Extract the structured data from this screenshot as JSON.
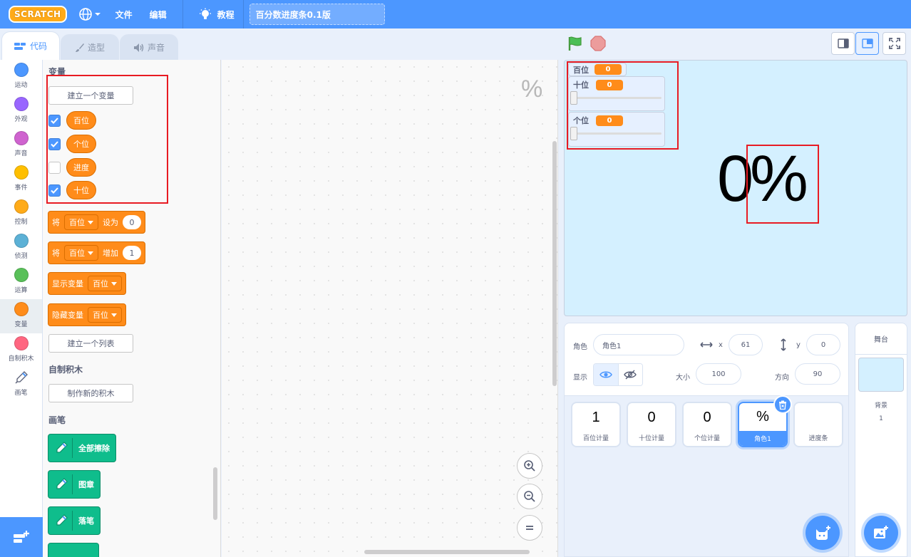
{
  "menubar": {
    "logo": "SCRATCH",
    "file": "文件",
    "edit": "编辑",
    "tutorials": "教程",
    "project_title": "百分数进度条0.1版"
  },
  "tabs": [
    {
      "label": "代码",
      "icon": "code-icon",
      "active": true
    },
    {
      "label": "造型",
      "icon": "brush-icon",
      "active": false
    },
    {
      "label": "声音",
      "icon": "speaker-icon",
      "active": false
    }
  ],
  "categories": [
    {
      "label": "运动",
      "color": "#4c97ff"
    },
    {
      "label": "外观",
      "color": "#9966ff"
    },
    {
      "label": "声音",
      "color": "#cf63cf"
    },
    {
      "label": "事件",
      "color": "#ffbf00"
    },
    {
      "label": "控制",
      "color": "#ffab19"
    },
    {
      "label": "侦测",
      "color": "#5cb1d6"
    },
    {
      "label": "运算",
      "color": "#59c059"
    },
    {
      "label": "变量",
      "color": "#ff8c1a",
      "active": true
    },
    {
      "label": "自制积木",
      "color": "#ff6680"
    },
    {
      "label": "画笔",
      "icon": "pen-icon"
    }
  ],
  "flyout": {
    "variables_heading": "变量",
    "make_variable": "建立一个变量",
    "variables": [
      {
        "name": "百位",
        "checked": true
      },
      {
        "name": "个位",
        "checked": true
      },
      {
        "name": "进度",
        "checked": false
      },
      {
        "name": "十位",
        "checked": true
      }
    ],
    "set_block": {
      "prefix": "将",
      "var": "百位",
      "verb": "设为",
      "value": "0"
    },
    "change_block": {
      "prefix": "将",
      "var": "百位",
      "verb": "增加",
      "value": "1"
    },
    "show_block": {
      "label": "显示变量",
      "var": "百位"
    },
    "hide_block": {
      "label": "隐藏变量",
      "var": "百位"
    },
    "make_list": "建立一个列表",
    "myblocks_heading": "自制积木",
    "make_block": "制作新的积木",
    "pen_heading": "画笔",
    "pen_blocks": [
      "全部擦除",
      "图章",
      "落笔"
    ]
  },
  "workspace": {
    "sprite_mark": "%"
  },
  "stage": {
    "monitors": [
      {
        "label": "百位",
        "value": "0",
        "mode": "normal"
      },
      {
        "label": "十位",
        "value": "0",
        "mode": "slider",
        "slider_fraction": 0
      },
      {
        "label": "个位",
        "value": "0",
        "mode": "slider",
        "slider_fraction": 0
      }
    ],
    "digit_text": "0",
    "percent_text": "%"
  },
  "sprite_info": {
    "sprite_label": "角色",
    "sprite_name": "角色1",
    "x_label": "x",
    "x_value": "61",
    "y_label": "y",
    "y_value": "0",
    "show_label": "显示",
    "size_label": "大小",
    "size_value": "100",
    "direction_label": "方向",
    "direction_value": "90"
  },
  "sprites": [
    {
      "thumb": "1",
      "name": "百位计量",
      "selected": false
    },
    {
      "thumb": "0",
      "name": "十位计量",
      "selected": false
    },
    {
      "thumb": "0",
      "name": "个位计量",
      "selected": false
    },
    {
      "thumb": "%",
      "name": "角色1",
      "selected": true
    },
    {
      "thumb": "",
      "name": "进度条",
      "selected": false
    }
  ],
  "stage_pane": {
    "header": "舞台",
    "backdrops_label": "背景",
    "backdrops_count": "1"
  },
  "colors": {
    "brand": "#4c97ff",
    "variables": "#ff8c1a",
    "pen": "#0fbd8c",
    "highlight": "#e81b23"
  }
}
